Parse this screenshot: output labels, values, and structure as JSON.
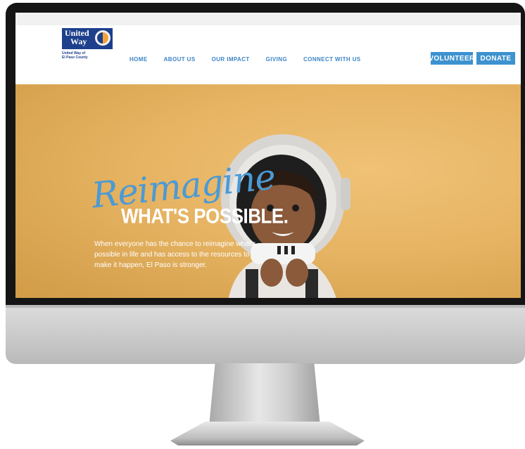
{
  "site": {
    "logo": {
      "line1": "United",
      "line2": "Way",
      "caption_line1": "United Way of",
      "caption_line2": "El Paso County"
    },
    "nav": [
      "HOME",
      "ABOUT US",
      "OUR IMPACT",
      "GIVING",
      "CONNECT WITH US"
    ],
    "buttons": {
      "volunteer": "VOLUNTEER",
      "donate": "DONATE"
    },
    "hero": {
      "script_word": "Reimagine",
      "headline": "WHAT'S POSSIBLE.",
      "body": "When everyone has the chance to reimagine what's possible in life and has access to the resources to make it happen, El Paso is stronger."
    }
  },
  "colors": {
    "brand_blue": "#1d3f8c",
    "nav_blue": "#3d85c6",
    "button_blue": "#3d92cf",
    "hero_background": "#e6b463"
  }
}
